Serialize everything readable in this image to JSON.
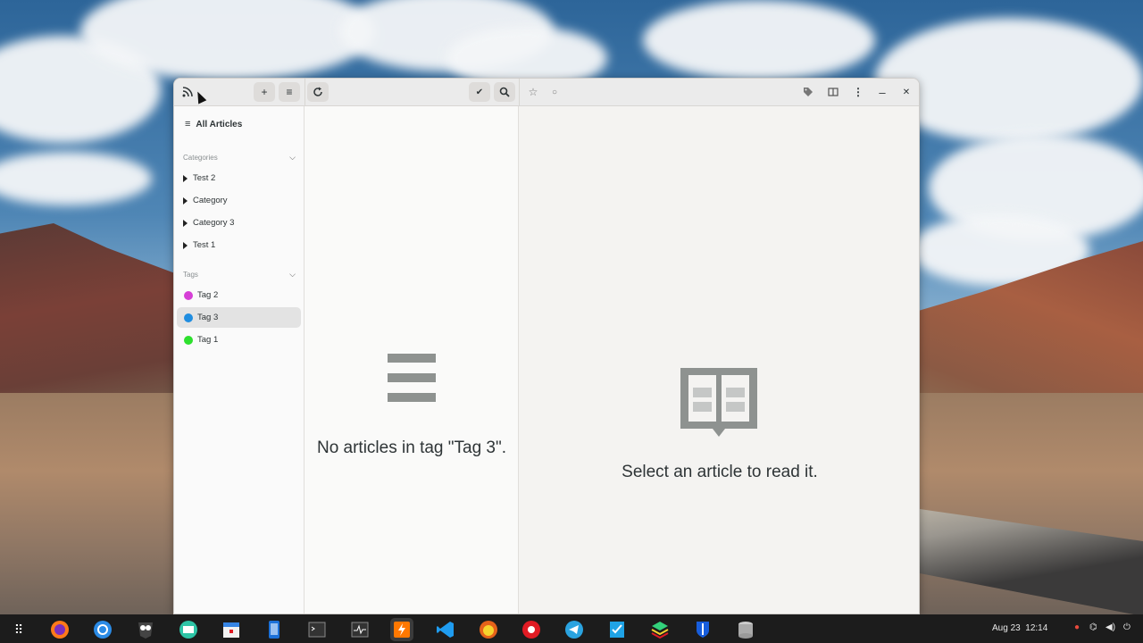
{
  "window": {
    "title_icon": "rss-feed-icon",
    "toolbar": {
      "add_icon": "plus-icon",
      "menu_icon": "hamburger-menu-icon",
      "refresh_icon": "refresh-icon",
      "mark_read_icon": "checkmark-icon",
      "search_icon": "search-icon",
      "star_icon": "star-icon",
      "unread_icon": "circle-icon",
      "tag_icon": "tag-icon",
      "reader_view_icon": "book-icon",
      "more_icon": "kebab-menu-icon",
      "minimize_label": "–",
      "close_label": "✕"
    }
  },
  "sidebar": {
    "all_articles_label": "All Articles",
    "categories_header": "Categories",
    "categories": [
      {
        "label": "Test 2"
      },
      {
        "label": "Category"
      },
      {
        "label": "Category 3"
      },
      {
        "label": "Test 1"
      }
    ],
    "tags_header": "Tags",
    "tags": [
      {
        "label": "Tag 2",
        "color": "#d63fd6",
        "selected": false
      },
      {
        "label": "Tag 3",
        "color": "#1f8de0",
        "selected": true
      },
      {
        "label": "Tag 1",
        "color": "#2ee02e",
        "selected": false
      }
    ]
  },
  "article_list": {
    "empty_message": "No articles in tag \"Tag 3\"."
  },
  "reader": {
    "empty_message": "Select an article to read it."
  },
  "taskbar": {
    "apps": [
      "app-grid-icon",
      "firefox-icon",
      "chromium-icon",
      "owl-icon",
      "mail-icon",
      "calendar-icon",
      "phone-icon",
      "terminal-icon",
      "system-monitor-icon",
      "newsreader-icon",
      "vscode-icon",
      "orange-app-icon",
      "lifesaver-icon",
      "telegram-icon",
      "tasks-icon",
      "layers-icon",
      "bitwarden-icon",
      "database-icon"
    ],
    "date": "Aug 23",
    "time": "12:14"
  }
}
